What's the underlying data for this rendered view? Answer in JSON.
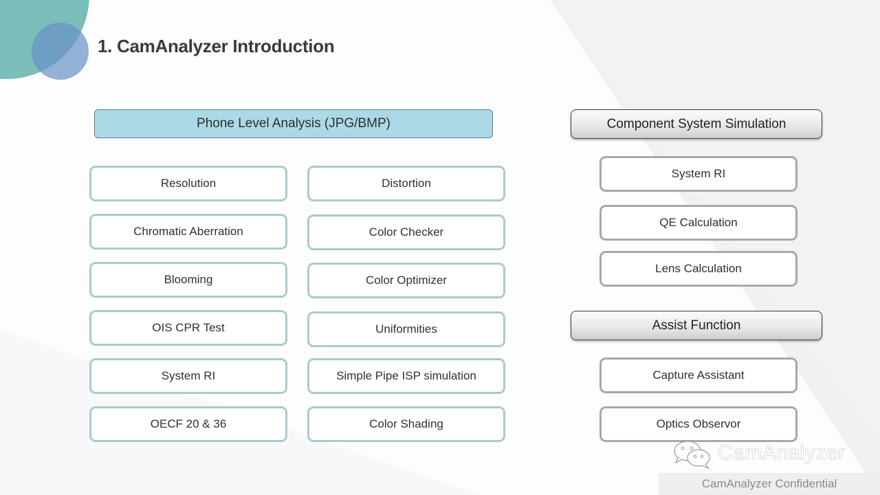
{
  "slide": {
    "title": "1. CamAnalyzer Introduction",
    "brand_watermark": "CamAnalyzer",
    "footer": "CamAnalyzer  Confidential",
    "icons": {
      "wechat": "wechat-icon"
    }
  },
  "phone_level": {
    "header": "Phone Level Analysis (JPG/BMP)",
    "left_column": [
      "Resolution",
      "Chromatic Aberration",
      "Blooming",
      "OIS CPR Test",
      "System RI",
      "OECF 20 & 36"
    ],
    "right_column": [
      "Distortion",
      "Color Checker",
      "Color Optimizer",
      "Uniformities",
      "Simple Pipe ISP simulation",
      "Color Shading"
    ]
  },
  "component_sim": {
    "header": "Component  System Simulation",
    "items": [
      "System RI",
      "QE Calculation",
      "Lens Calculation"
    ]
  },
  "assist": {
    "header": "Assist Function",
    "items": [
      "Capture Assistant",
      "Optics Observor"
    ]
  },
  "colors": {
    "teal_circle": "#7bbdb9",
    "blue_circle": "#6a92c8",
    "blue_header": "#acd9e7",
    "teal_border": "#a9cbcc",
    "gray_border": "#a8a8a8"
  }
}
